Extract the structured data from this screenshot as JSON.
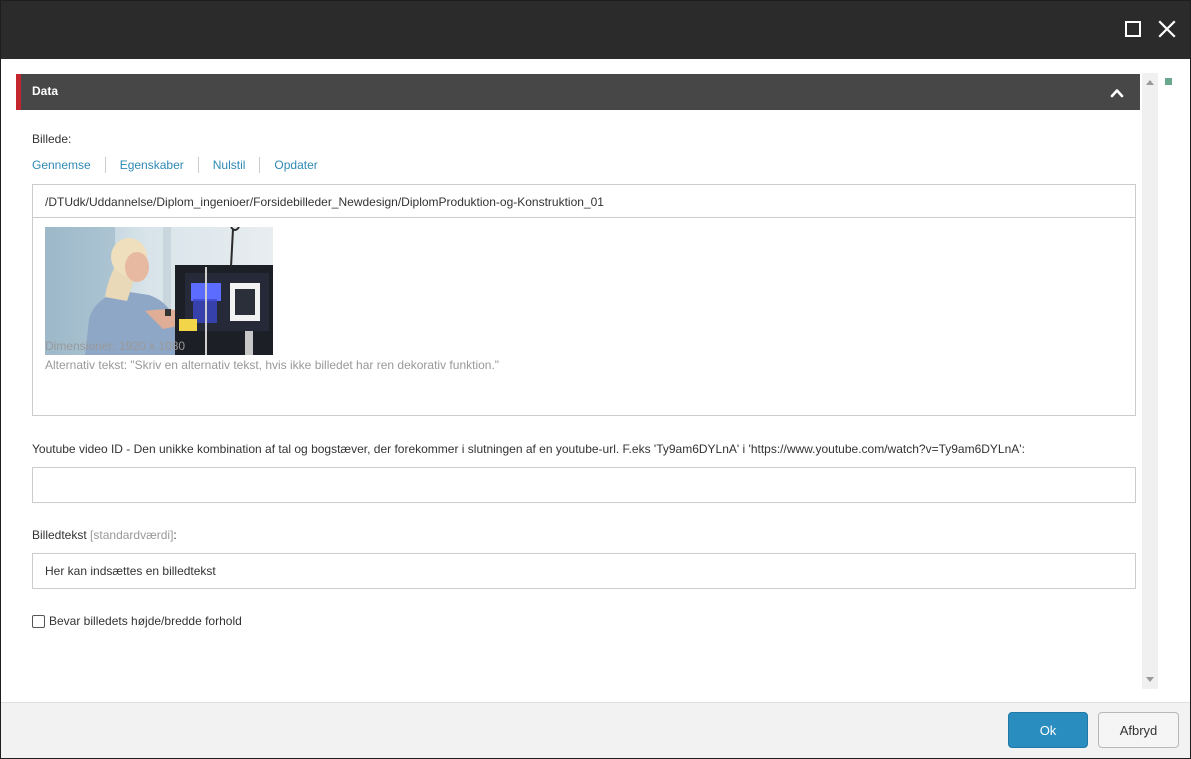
{
  "window": {
    "controls": [
      "maximize-icon",
      "close-icon"
    ]
  },
  "section": {
    "title": "Data",
    "collapse_icon": "chevron-up-icon"
  },
  "image_field": {
    "label": "Billede:",
    "actions": [
      "Gennemse",
      "Egenskaber",
      "Nulstil",
      "Opdater"
    ],
    "path": "/DTUdk/Uddannelse/Diplom_ingenioer/Forsidebilleder_Newdesign/DiplomProduktion-og-Konstruktion_01",
    "dimensions": "Dimensioner: 1920 x 1080",
    "alt_text": "Alternativ tekst: \"Skriv en alternativ tekst, hvis ikke billedet har ren dekorativ funktion.\""
  },
  "youtube_field": {
    "label": "Youtube video ID - Den unikke kombination af tal og bogstæver, der forekommer i slutningen af en youtube-url. F.eks 'Ty9am6DYLnA' i 'https://www.youtube.com/watch?v=Ty9am6DYLnA':",
    "value": ""
  },
  "caption_field": {
    "label": "Billedtekst",
    "default_hint": "[standardværdi]",
    "label_suffix": ":",
    "value": "Her kan indsættes en billedtekst"
  },
  "aspect_checkbox": {
    "label": "Bevar billedets højde/bredde forhold",
    "checked": false
  },
  "footer": {
    "ok_label": "Ok",
    "cancel_label": "Afbryd"
  },
  "colors": {
    "titlebar": "#2b2b2b",
    "section_header": "#474747",
    "section_accent": "#c5252d",
    "link": "#2f8ab5",
    "primary_button": "#2a8dbf",
    "nav_marker": "#6aa88d"
  }
}
